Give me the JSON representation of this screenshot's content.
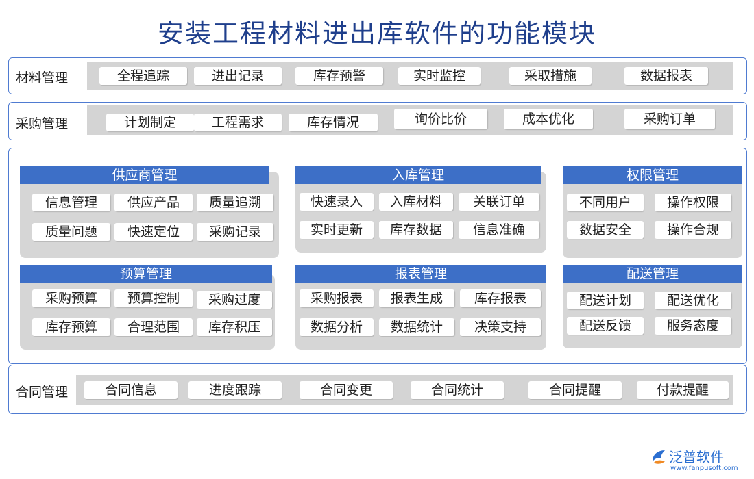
{
  "title": "安装工程材料进出库软件的功能模块",
  "material": {
    "label": "材料管理",
    "items": [
      "全程追踪",
      "进出记录",
      "库存预警",
      "实时监控",
      "采取措施",
      "数据报表"
    ]
  },
  "purchase": {
    "label": "采购管理",
    "items": [
      "计划制定",
      "工程需求",
      "库存情况",
      "询价比价",
      "成本优化",
      "采购订单"
    ]
  },
  "groups": {
    "supplier": {
      "title": "供应商管理",
      "items": [
        "信息管理",
        "供应产品",
        "质量追溯",
        "质量问题",
        "快速定位",
        "采购记录"
      ]
    },
    "inbound": {
      "title": "入库管理",
      "items": [
        "快速录入",
        "入库材料",
        "关联订单",
        "实时更新",
        "库存数据",
        "信息准确"
      ]
    },
    "permission": {
      "title": "权限管理",
      "items": [
        "不同用户",
        "操作权限",
        "数据安全",
        "操作合规"
      ]
    },
    "budget": {
      "title": "预算管理",
      "items": [
        "采购预算",
        "预算控制",
        "采购过度",
        "库存预算",
        "合理范围",
        "库存积压"
      ]
    },
    "report": {
      "title": "报表管理",
      "items": [
        "采购报表",
        "报表生成",
        "库存报表",
        "数据分析",
        "数据统计",
        "决策支持"
      ]
    },
    "delivery": {
      "title": "配送管理",
      "items": [
        "配送计划",
        "配送优化",
        "配送反馈",
        "服务态度"
      ]
    }
  },
  "contract": {
    "label": "合同管理",
    "items": [
      "合同信息",
      "进度跟踪",
      "合同变更",
      "合同统计",
      "合同提醒",
      "付款提醒"
    ]
  },
  "logo": {
    "name": "泛普软件",
    "url": "www.fanpusoft.com",
    "color": "#2b6fd1"
  }
}
